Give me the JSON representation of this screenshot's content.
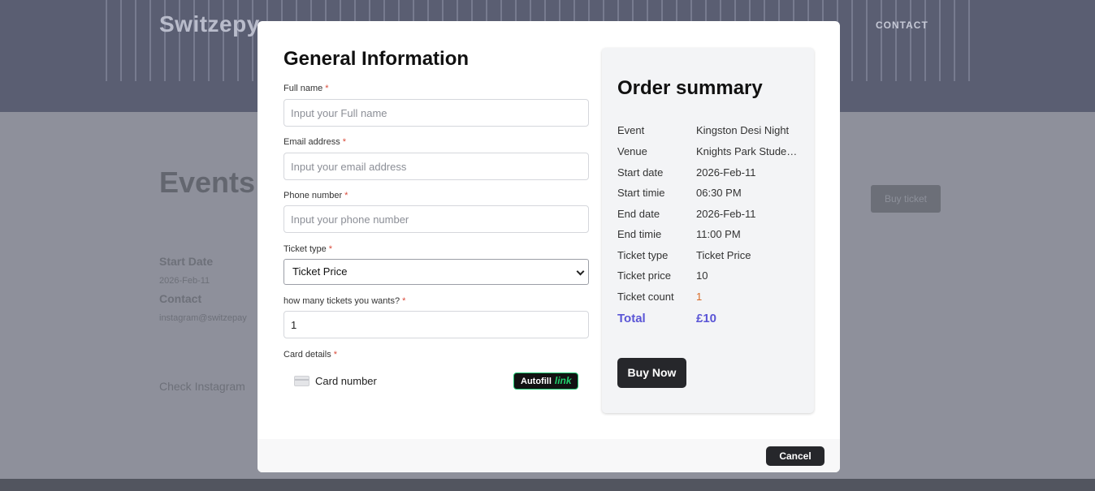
{
  "background": {
    "logo": "Switzepy",
    "nav_contact": "CONTACT",
    "page_title": "Events",
    "buy_button": "Buy ticket",
    "start_date_label": "Start Date",
    "start_date_value": "2026-Feb-11",
    "contact_label": "Contact",
    "contact_value": "instagram@switzepay",
    "check_text": "Check Instagram"
  },
  "form": {
    "title": "General Information",
    "required_mark": "*",
    "full_name": {
      "label": "Full name",
      "placeholder": "Input your Full name",
      "value": ""
    },
    "email": {
      "label": "Email address",
      "placeholder": "Input your email address",
      "value": ""
    },
    "phone": {
      "label": "Phone number",
      "placeholder": "Input your phone number",
      "value": ""
    },
    "ticket_type": {
      "label": "Ticket type",
      "selected": "Ticket Price"
    },
    "ticket_count": {
      "label": "how many tickets you wants?",
      "value": "1"
    },
    "card": {
      "label": "Card details",
      "placeholder": "Card number",
      "autofill_label": "Autofill",
      "autofill_link": "link"
    }
  },
  "summary": {
    "title": "Order summary",
    "rows": [
      {
        "key": "Event",
        "value": "Kingston Desi Night"
      },
      {
        "key": "Venue",
        "value": "Knights Park Student..."
      },
      {
        "key": "Start date",
        "value": "2026-Feb-11"
      },
      {
        "key": "Start timie",
        "value": "06:30 PM"
      },
      {
        "key": "End date",
        "value": "2026-Feb-11"
      },
      {
        "key": "End timie",
        "value": "11:00 PM"
      },
      {
        "key": "Ticket type",
        "value": "Ticket Price"
      },
      {
        "key": "Ticket price",
        "value": "10"
      },
      {
        "key": "Ticket count",
        "value": "1"
      }
    ],
    "total_label": "Total",
    "total_value": "£10",
    "buy_button": "Buy Now"
  },
  "footer": {
    "cancel_button": "Cancel"
  },
  "colors": {
    "accent_total": "#5a55d6",
    "count_highlight": "#d86a25",
    "button_dark": "#26272b",
    "link_green": "#21d26e"
  }
}
